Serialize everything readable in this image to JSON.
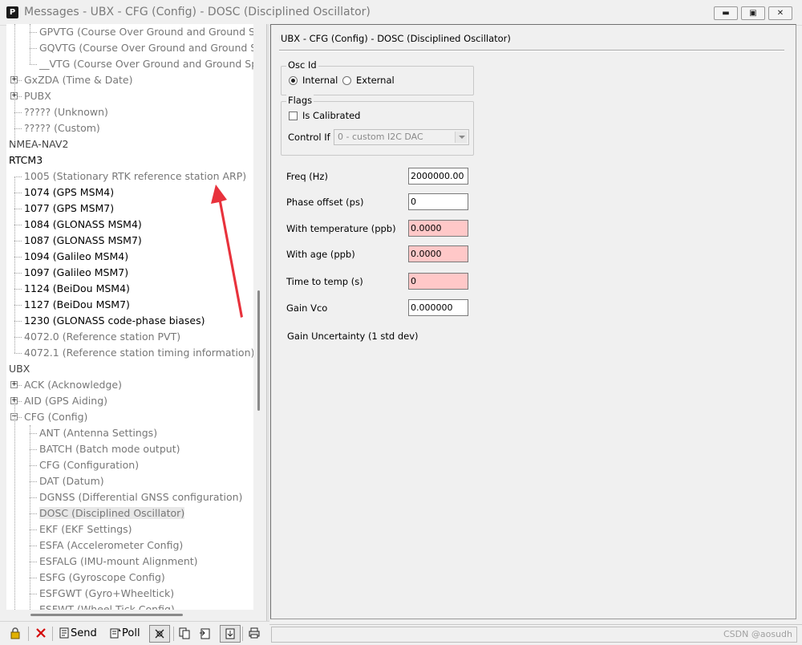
{
  "window": {
    "title": "Messages - UBX - CFG (Config) - DOSC (Disciplined Oscillator)",
    "app_icon": "P",
    "controls": [
      "minimize-icon",
      "maximize-icon",
      "close-icon"
    ]
  },
  "tree": {
    "items": [
      {
        "label": "GPVTG (Course Over Ground and Ground Spe",
        "level": 2,
        "style": "grey"
      },
      {
        "label": "GQVTG (Course Over Ground and Ground Sp",
        "level": 2,
        "style": "grey"
      },
      {
        "label": "__VTG (Course Over Ground and Ground Spee",
        "level": 2,
        "style": "grey"
      },
      {
        "label": "GxZDA (Time & Date)",
        "level": 1,
        "style": "grey",
        "expander": "+"
      },
      {
        "label": "PUBX",
        "level": 1,
        "style": "grey",
        "expander": "+"
      },
      {
        "label": "????? (Unknown)",
        "level": 1,
        "style": "grey"
      },
      {
        "label": "????? (Custom)",
        "level": 1,
        "style": "grey"
      },
      {
        "label": "NMEA-NAV2",
        "level": 0,
        "style": "section"
      },
      {
        "label": "RTCM3",
        "level": 0,
        "style": "black"
      },
      {
        "label": "1005 (Stationary RTK reference station ARP)",
        "level": 1,
        "style": "grey"
      },
      {
        "label": "1074 (GPS MSM4)",
        "level": 1,
        "style": "black"
      },
      {
        "label": "1077 (GPS MSM7)",
        "level": 1,
        "style": "black"
      },
      {
        "label": "1084 (GLONASS MSM4)",
        "level": 1,
        "style": "black"
      },
      {
        "label": "1087 (GLONASS MSM7)",
        "level": 1,
        "style": "black"
      },
      {
        "label": "1094 (Galileo MSM4)",
        "level": 1,
        "style": "black"
      },
      {
        "label": "1097 (Galileo MSM7)",
        "level": 1,
        "style": "black"
      },
      {
        "label": "1124 (BeiDou MSM4)",
        "level": 1,
        "style": "black"
      },
      {
        "label": "1127 (BeiDou MSM7)",
        "level": 1,
        "style": "black"
      },
      {
        "label": "1230 (GLONASS code-phase biases)",
        "level": 1,
        "style": "black"
      },
      {
        "label": "4072.0 (Reference station PVT)",
        "level": 1,
        "style": "grey"
      },
      {
        "label": "4072.1 (Reference station timing information)",
        "level": 1,
        "style": "grey"
      },
      {
        "label": "UBX",
        "level": 0,
        "style": "section"
      },
      {
        "label": "ACK (Acknowledge)",
        "level": 1,
        "style": "grey",
        "expander": "+"
      },
      {
        "label": "AID (GPS Aiding)",
        "level": 1,
        "style": "grey",
        "expander": "+"
      },
      {
        "label": "CFG (Config)",
        "level": 1,
        "style": "grey",
        "expander": "-"
      },
      {
        "label": "ANT (Antenna Settings)",
        "level": 2,
        "style": "grey"
      },
      {
        "label": "BATCH (Batch mode output)",
        "level": 2,
        "style": "grey"
      },
      {
        "label": "CFG (Configuration)",
        "level": 2,
        "style": "grey"
      },
      {
        "label": "DAT (Datum)",
        "level": 2,
        "style": "grey"
      },
      {
        "label": "DGNSS (Differential GNSS configuration)",
        "level": 2,
        "style": "grey"
      },
      {
        "label": "DOSC (Disciplined Oscillator)",
        "level": 2,
        "style": "grey",
        "selected": true
      },
      {
        "label": "EKF (EKF Settings)",
        "level": 2,
        "style": "grey"
      },
      {
        "label": "ESFA (Accelerometer Config)",
        "level": 2,
        "style": "grey"
      },
      {
        "label": "ESFALG (IMU-mount Alignment)",
        "level": 2,
        "style": "grey"
      },
      {
        "label": "ESFG (Gyroscope Config)",
        "level": 2,
        "style": "grey"
      },
      {
        "label": "ESFGWT (Gyro+Wheeltick)",
        "level": 2,
        "style": "grey"
      },
      {
        "label": "ESFWT (Wheel Tick Config)",
        "level": 2,
        "style": "grey"
      }
    ]
  },
  "toolbar": {
    "send_label": "Send",
    "poll_label": "Poll",
    "icons": [
      "lock-icon",
      "delete-icon",
      "send-icon",
      "poll-icon",
      "auto-poll-icon",
      "copy-icon",
      "paste-icon",
      "save-icon",
      "print-icon"
    ]
  },
  "form": {
    "title": "UBX - CFG (Config) - DOSC (Disciplined Oscillator)",
    "osc_id": {
      "legend": "Osc Id",
      "option_internal": "Internal",
      "option_external": "External",
      "selected": "Internal"
    },
    "flags": {
      "legend": "Flags",
      "is_calibrated_label": "Is Calibrated",
      "is_calibrated": false,
      "control_if_label": "Control If",
      "control_if_value": "0  - custom I2C DAC"
    },
    "fields": [
      {
        "label": "Freq (Hz)",
        "value": "2000000.00",
        "error": false
      },
      {
        "label": "Phase offset (ps)",
        "value": "0",
        "error": false
      },
      {
        "label": "With temperature (ppb)",
        "value": "0.0000",
        "error": true
      },
      {
        "label": "With age (ppb)",
        "value": "0.0000",
        "error": true
      },
      {
        "label": "Time to temp (s)",
        "value": "0",
        "error": true
      },
      {
        "label": "Gain Vco",
        "value": "0.000000",
        "error": false
      }
    ],
    "gain_uncertainty_label": "Gain Uncertainty (1 std dev)"
  },
  "status": {
    "watermark": "CSDN @aosudh"
  },
  "colors": {
    "error_field": "#ffc8c8",
    "annotation_arrow": "#e8323c",
    "grey_text": "#777777"
  }
}
